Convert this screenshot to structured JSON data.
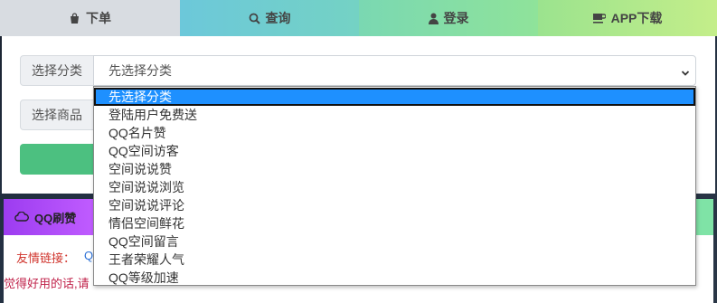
{
  "tabs": [
    {
      "label": "下单",
      "icon": "shopping-bag-icon"
    },
    {
      "label": "查询",
      "icon": "search-icon"
    },
    {
      "label": "登录",
      "icon": "user-icon"
    },
    {
      "label": "APP下载",
      "icon": "coffee-cup-icon"
    }
  ],
  "form": {
    "category_label": "选择分类",
    "category_value": "先选择分类",
    "product_label": "选择商品"
  },
  "dropdown": {
    "selected_index": 0,
    "options": [
      "先选择分类",
      "登陆用户免费送",
      "QQ名片赞",
      "QQ空间访客",
      "空间说说赞",
      "空间说说浏览",
      "空间说说评论",
      "情侣空间鲜花",
      "QQ空间留言",
      "王者荣耀人气",
      "QQ等级加速"
    ]
  },
  "section": {
    "qq_title": "QQ刷赞",
    "qq_icon": "cloud-icon",
    "links_label": "友情链接：",
    "links_value": "QQ",
    "footer_note": "觉得好用的话,请"
  },
  "colors": {
    "selected_option": "#1e90ff",
    "submit_green": "#4cc080",
    "qq_strip_purple": "#9c3cf0",
    "links_label_red": "#d0342c"
  }
}
